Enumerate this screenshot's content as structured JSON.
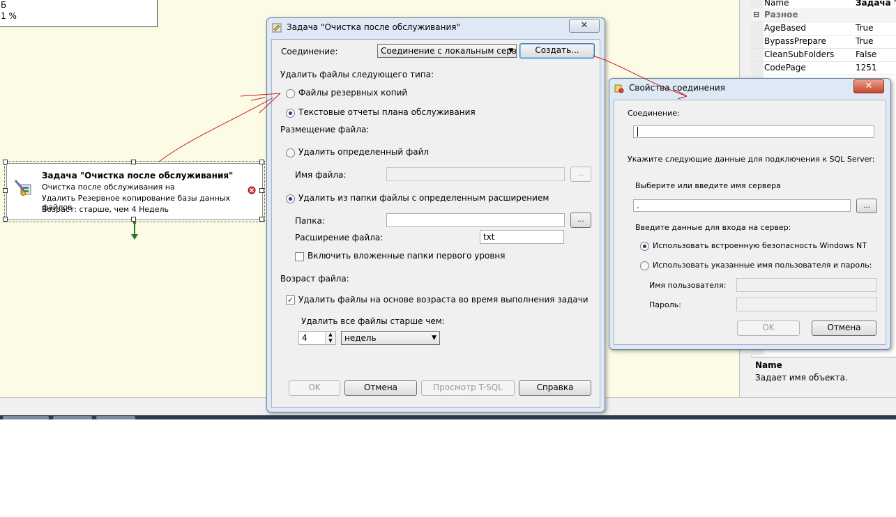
{
  "designer": {
    "top_box_lines": [
      "Б",
      "1 %"
    ],
    "task": {
      "title": "Задача \"Очистка после обслуживания\"",
      "line1": "Очистка после обслуживания на",
      "line2": "Удалить Резервное копирование базы данных файлов",
      "line3": "Возраст: старше, чем 4 Недель"
    }
  },
  "main_dialog": {
    "title": "Задача \"Очистка после обслуживания\"",
    "close_glyph": "✕",
    "connection_label": "Соединение:",
    "connection_value": "Соединение с локальным серве",
    "create_button": "Создать...",
    "delete_type_label": "Удалить файлы следующего типа:",
    "radio_backup": "Файлы резервных копий",
    "radio_reports": "Текстовые отчеты плана обслуживания",
    "placement_label": "Размещение файла:",
    "radio_specific": "Удалить определенный файл",
    "file_name_label": "Имя файла:",
    "browse_glyph": "...",
    "radio_folder": "Удалить из папки файлы с определенным расширением",
    "folder_label": "Папка:",
    "folder_value": "",
    "ext_label": "Расширение файла:",
    "ext_value": "txt",
    "include_subfolders": "Включить вложенные папки первого уровня",
    "age_label": "Возраст файла:",
    "age_check": "Удалить файлы на основе возраста во время выполнения задачи",
    "older_than_label": "Удалить все файлы старше чем:",
    "age_number": "4",
    "age_unit": "недель",
    "ok": "OK",
    "cancel": "Отмена",
    "tsql": "Просмотр T-SQL",
    "help": "Справка"
  },
  "conn_dialog": {
    "title": "Свойства соединения",
    "close_glyph": "✕",
    "connection_label": "Соединение:",
    "connection_value": "",
    "specify_label": "Укажите следующие данные для подключения к SQL Server:",
    "server_label": "Выберите или введите имя сервера",
    "server_value": ".",
    "browse_glyph": "...",
    "login_label": "Введите данные для входа на сервер:",
    "radio_windows": "Использовать встроенную безопасность Windows NT",
    "radio_user": "Использовать указанные имя пользователя и пароль:",
    "username_label": "Имя пользователя:",
    "password_label": "Пароль:",
    "ok": "OK",
    "cancel": "Отмена"
  },
  "properties": {
    "header_key": "Name",
    "header_value": "Задача \"О",
    "category": "Разное",
    "category_toggle": "⊟",
    "rows": [
      {
        "key": "AgeBased",
        "value": "True"
      },
      {
        "key": "BypassPrepare",
        "value": "True"
      },
      {
        "key": "CleanSubFolders",
        "value": "False"
      },
      {
        "key": "CodePage",
        "value": "1251"
      }
    ],
    "desc_title": "Name",
    "desc_text": "Задает имя объекта."
  },
  "colors": {
    "designer_bg": "#fcfbe5",
    "dialog_frame": "#dfe9f5",
    "annotation_red": "#c0201a"
  }
}
